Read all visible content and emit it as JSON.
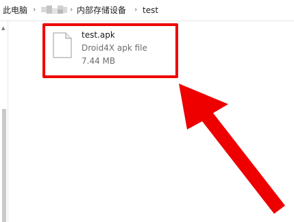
{
  "breadcrumb": {
    "items": [
      "此电脑",
      "内部存储设备",
      "test"
    ],
    "separator": "›"
  },
  "file": {
    "name": "test.apk",
    "type": "Droid4X apk file",
    "size": "7.44 MB",
    "icon": "generic-document-icon"
  },
  "annotation": {
    "highlight_color": "#ee0000",
    "arrow_color": "#ee0000"
  }
}
